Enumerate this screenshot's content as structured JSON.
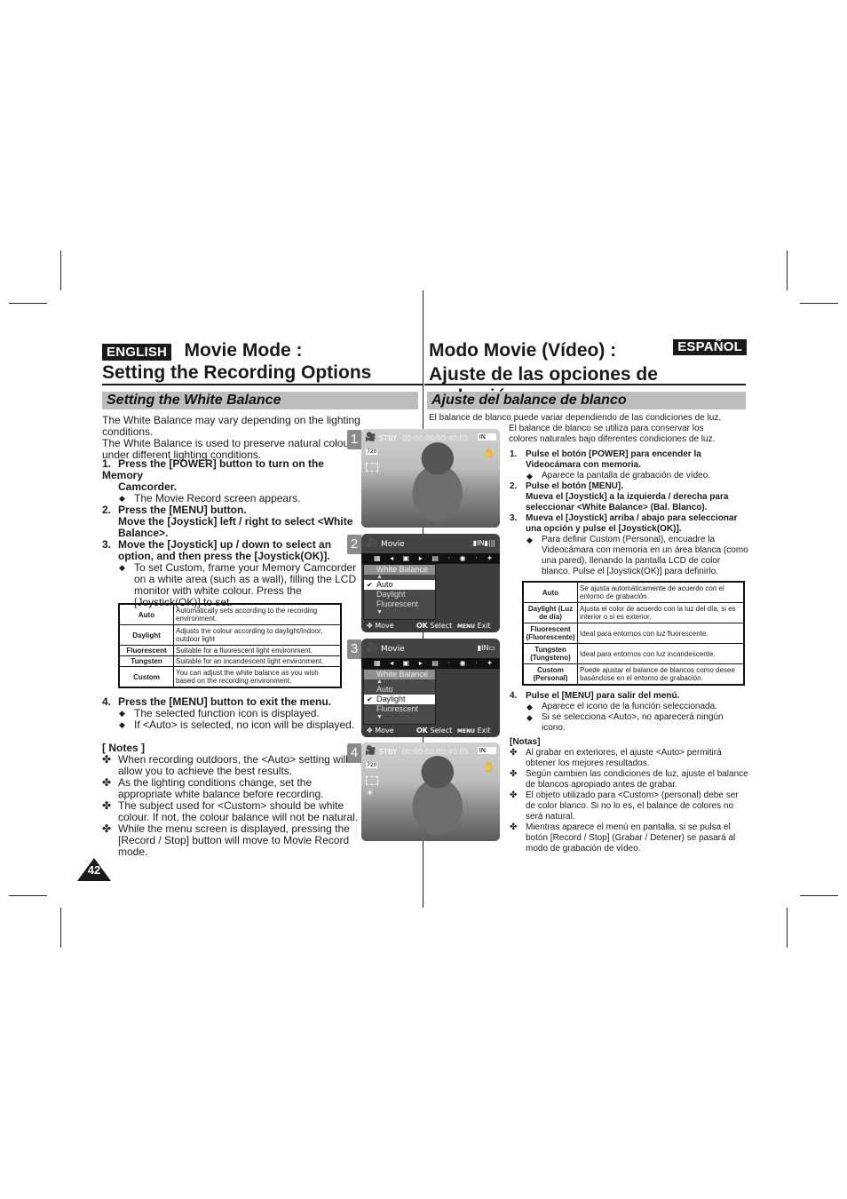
{
  "english": {
    "lang_badge": "ENGLISH",
    "title_line1": "Movie Mode :",
    "title_line2": "Setting the Recording Options",
    "section_title": "Setting the White Balance",
    "intro": [
      "The White Balance may vary depending on the lighting conditions.",
      "The White Balance is used to preserve natural colours",
      "under different lighting conditions."
    ],
    "steps": [
      {
        "num": "1.",
        "lines": [
          "Press the [POWER] button to turn on the Memory",
          "Camcorder."
        ],
        "bullets": [
          "The Movie Record screen appears."
        ]
      },
      {
        "num": "2.",
        "lines": [
          "Press the [MENU] button.",
          "Move the [Joystick] left / right to select <White",
          "Balance>."
        ],
        "bullets": []
      },
      {
        "num": "3.",
        "lines": [
          "Move the [Joystick] up / down to select an",
          "option, and then press the [Joystick(OK)]."
        ],
        "bullets": [
          "To set Custom, frame your Memory Camcorder on a white area (such as a wall), filling the LCD monitor with white colour. Press the [Joystick(OK)] to set."
        ]
      },
      {
        "num": "4.",
        "lines": [
          "Press the [MENU] button to exit the menu."
        ],
        "bullets": [
          "The selected function icon is displayed.",
          "If <Auto> is selected, no icon will be displayed."
        ]
      }
    ],
    "table": [
      {
        "key": "Auto",
        "value": "Automatically sets according to the recording environment."
      },
      {
        "key": "Daylight",
        "value": "Adjusts the colour according to daylight/indoor, outdoor light"
      },
      {
        "key": "Fluorescent",
        "value": "Suitable for a fluorescent light environment."
      },
      {
        "key": "Tungsten",
        "value": "Suitable for an incandescent light environment."
      },
      {
        "key": "Custom",
        "value": "You can adjust the white balance as you wish based on the recording environment."
      }
    ],
    "notes_title": "[ Notes ]",
    "notes": [
      "When recording outdoors, the <Auto> setting will allow you to achieve the best results.",
      "As the lighting conditions change, set the appropriate white balance before recording.",
      "The subject used for <Custom> should be white colour. If not, the colour balance will not be natural.",
      "While the menu screen is displayed, pressing the [Record / Stop] button will move to Movie Record mode."
    ],
    "page_number": "42"
  },
  "spanish": {
    "lang_badge": "ESPAÑOL",
    "title_line1": "Modo Movie (Vídeo) :",
    "title_line2": "Ajuste de las opciones de grabación",
    "section_title": "Ajuste del balance de blanco",
    "intro": [
      "El balance de blanco puede variar dependiendo de las condiciones de luz.",
      "El balance de blanco se utiliza para conservar los",
      "colores naturales bajo diferentes condiciones de luz."
    ],
    "steps": [
      {
        "num": "1.",
        "lines": [
          "Pulse el botón [POWER] para encender la",
          "Videocámara con memoria."
        ],
        "bullets": [
          "Aparece la pantalla de grabación de vídeo."
        ]
      },
      {
        "num": "2.",
        "lines": [
          "Pulse el botón [MENU].",
          "Mueva el [Joystick] a la izquierda / derecha para",
          "seleccionar <White Balance> (Bal. Blanco)."
        ],
        "bullets": []
      },
      {
        "num": "3.",
        "lines": [
          "Mueva el [Joystick] arriba / abajo para seleccionar",
          "una opción y pulse el [Joystick(OK)]."
        ],
        "bullets": [
          "Para definir Custom (Personal), encuadre la Videocámara con memoria en un área blanca (como una pared), llenando la pantalla LCD de color blanco. Pulse el [Joystick(OK)] para definirlo."
        ]
      },
      {
        "num": "4.",
        "lines": [
          "Pulse el [MENU] para salir del menú."
        ],
        "bullets": [
          "Aparece el icono de la función seleccionada.",
          "Si se selecciona <Auto>, no aparecerá ningún icono."
        ]
      }
    ],
    "table": [
      {
        "key": "Auto",
        "value": "Se ajusta automáticamente de acuerdo con el entorno de grabación."
      },
      {
        "key": "Daylight (Luz de día)",
        "value": "Ajusta el color de acuerdo con la luz del día, si es interior o si es exterior."
      },
      {
        "key": "Fluorescent (Fluorescente)",
        "value": "Ideal para entornos con luz fluorescente."
      },
      {
        "key": "Tungsten (Tungsteno)",
        "value": "Ideal para entornos con luz incandescente."
      },
      {
        "key": "Custom (Personal)",
        "value": "Puede ajustar el balance de blancos como desee basándose en el entorno de grabación."
      }
    ],
    "notes_title": "[Notas]",
    "notes": [
      "Al grabar en exteriores, el ajuste <Auto> permitirá obtener los mejores resultados.",
      "Según cambien las condiciones de luz, ajuste el balance de blancos apropiado antes de grabar.",
      "El objeto utilizado para <Custom> (personal) debe ser de color blanco. Si no lo es, el balance de colores no será natural.",
      "Mientras aparece el menú en pantalla, si se pulsa el botón [Record / Stop] (Grabar / Detener) se pasará al modo de grabación de vídeo."
    ]
  },
  "screens": [
    {
      "num": "1",
      "type": "record",
      "status": "STBY",
      "timecode": "00:00:00/00:40:05",
      "battery": "IN",
      "icons": [
        "camcorder-icon",
        "720-quality-icon",
        "quality-icon",
        "hand-shake-icon"
      ]
    },
    {
      "num": "2",
      "type": "menu",
      "mode": "Movie",
      "menu_header": "White Balance",
      "items": [
        "Auto",
        "Daylight",
        "Fluorescent"
      ],
      "selected": "Auto",
      "footer": {
        "move": "Move",
        "ok_key": "OK",
        "select": "Select",
        "menu_key": "MENU",
        "exit": "Exit"
      }
    },
    {
      "num": "3",
      "type": "menu",
      "mode": "Movie",
      "menu_header": "White Balance",
      "items": [
        "Auto",
        "Daylight",
        "Fluorescent"
      ],
      "selected": "Daylight",
      "footer": {
        "move": "Move",
        "ok_key": "OK",
        "select": "Select",
        "menu_key": "MENU",
        "exit": "Exit"
      }
    },
    {
      "num": "4",
      "type": "record",
      "status": "STBY",
      "timecode": "00:00:00/00:40:05",
      "battery": "IN",
      "icons": [
        "camcorder-icon",
        "720-quality-icon",
        "quality-icon",
        "daylight-icon",
        "hand-shake-icon"
      ]
    }
  ]
}
